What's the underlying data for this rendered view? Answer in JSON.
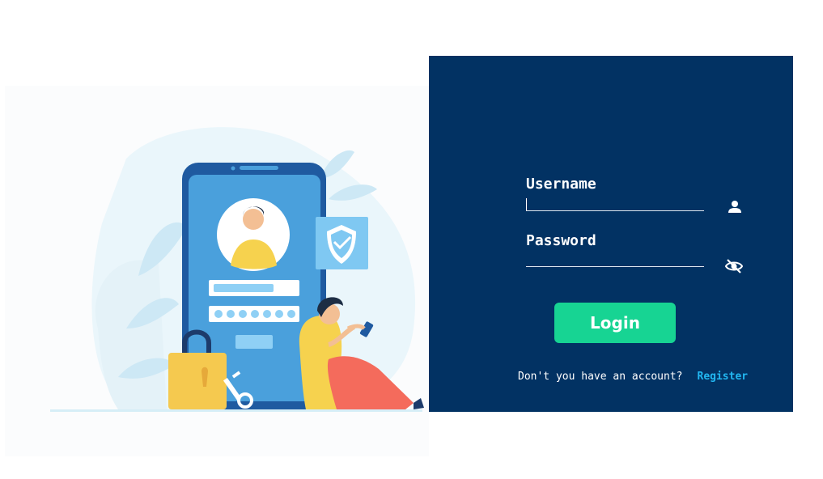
{
  "login": {
    "username_label": "Username",
    "password_label": "Password",
    "username_value": "",
    "password_value": "",
    "login_button": "Login",
    "no_account_text": "Don't you have an account?",
    "register_link": "Register"
  },
  "icons": {
    "username": "user-icon",
    "password": "eye-slash-icon"
  },
  "colors": {
    "panel_bg": "#023263",
    "login_button": "#17d493",
    "register_link": "#22b7f1"
  }
}
